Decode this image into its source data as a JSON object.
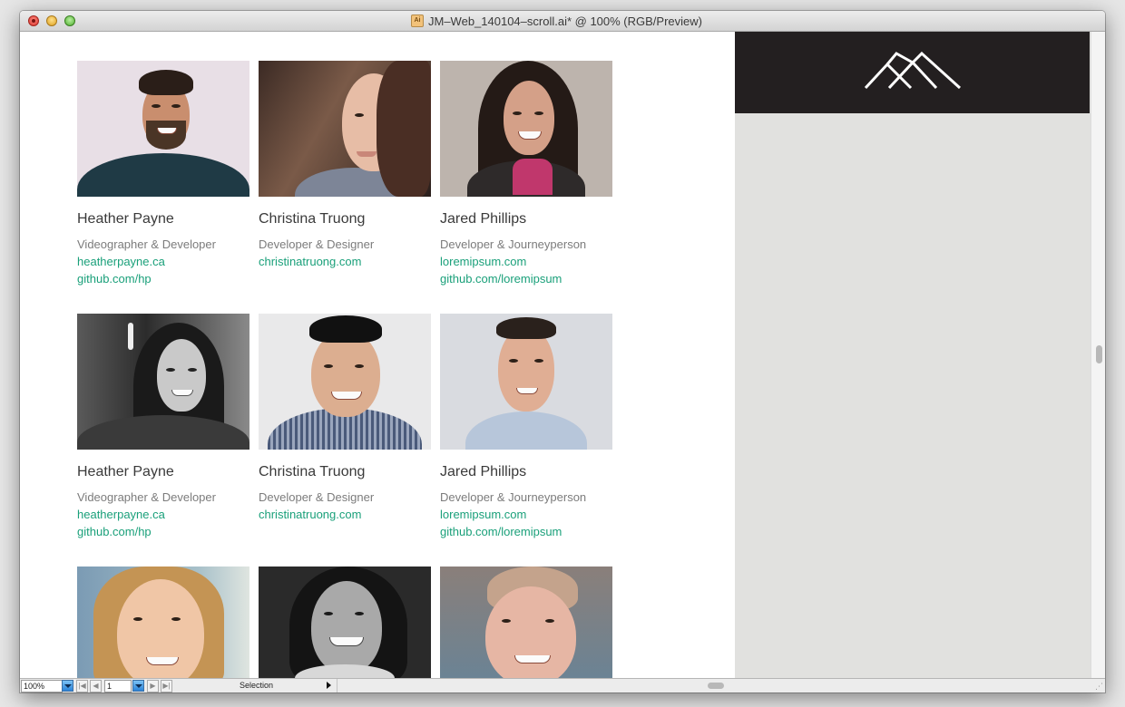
{
  "window": {
    "title": "JM–Web_140104–scroll.ai* @ 100% (RGB/Preview)",
    "doc_icon": "Ai"
  },
  "colors": {
    "link": "#1aa07a",
    "name": "#3a3a3a",
    "role": "#7c7c7c",
    "logo_bar": "#231f20",
    "pasteboard": "#e1e1df"
  },
  "logo": {
    "icon": "mountain-logo-icon"
  },
  "team": [
    {
      "name": "Heather Payne",
      "role": "Videographer & Developer",
      "links": [
        "heatherpayne.ca",
        "github.com/hp"
      ]
    },
    {
      "name": "Christina Truong",
      "role": "Developer & Designer",
      "links": [
        "christinatruong.com"
      ]
    },
    {
      "name": "Jared Phillips",
      "role": "Developer & Journeyperson",
      "links": [
        "loremipsum.com",
        "github.com/loremipsum"
      ]
    },
    {
      "name": "Heather Payne",
      "role": "Videographer & Developer",
      "links": [
        "heatherpayne.ca",
        "github.com/hp"
      ]
    },
    {
      "name": "Christina Truong",
      "role": "Developer & Designer",
      "links": [
        "christinatruong.com"
      ]
    },
    {
      "name": "Jared Phillips",
      "role": "Developer & Journeyperson",
      "links": [
        "loremipsum.com",
        "github.com/loremipsum"
      ]
    }
  ],
  "statusbar": {
    "zoom": "100%",
    "page": "1",
    "tool": "Selection"
  }
}
